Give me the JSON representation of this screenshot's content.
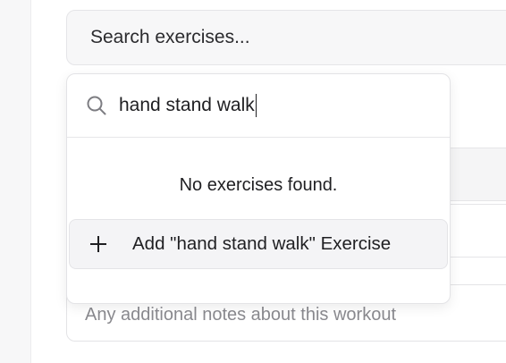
{
  "search_trigger": {
    "placeholder": "Search exercises..."
  },
  "dropdown": {
    "query": "hand stand walk",
    "search_icon": "search-icon",
    "empty_message": "No exercises found.",
    "add_action": {
      "icon": "plus-icon",
      "label": "Add \"hand stand walk\" Exercise"
    }
  },
  "notes": {
    "placeholder": "Any additional notes about this workout"
  }
}
